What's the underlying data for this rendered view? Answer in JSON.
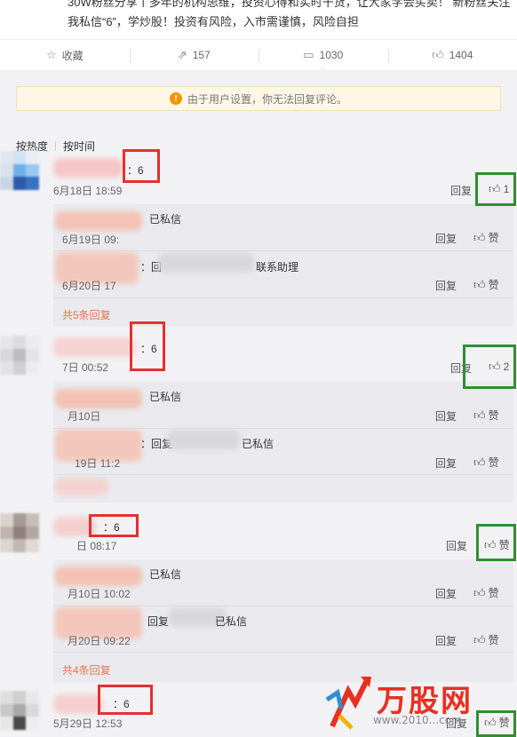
{
  "post": {
    "text": "30W粉丝分享丨多年的机构思维，投资心得和实时干货，让大家学会买卖！ 新粉丝关注我私信“6”，学炒股！投资有风险，入市需谨慎，风险自担"
  },
  "actions": {
    "favorite": "收藏",
    "forward": "157",
    "comment": "1030",
    "like": "1404"
  },
  "notice": "由于用户设置，你无法回复评论。",
  "sort": {
    "hot": "按热度",
    "time": "按时间"
  },
  "comments": [
    {
      "text": "：6",
      "time": "6月18日 18:59",
      "reply": "回复",
      "likes": "1",
      "subs": [
        {
          "text": "已私信",
          "time": "6月19日 09:",
          "reply": "回复",
          "like": "赞"
        },
        {
          "text": "：回",
          "text2": "联系助理",
          "time": "6月20日 17",
          "reply": "回复",
          "like": "赞"
        }
      ],
      "more": "共5条回复"
    },
    {
      "text": "：6",
      "time": "7日 00:52",
      "reply": "回复",
      "likes": "2",
      "subs": [
        {
          "text": "已私信",
          "time": "月10日",
          "reply": "回复",
          "like": "赞"
        },
        {
          "text": "：回复",
          "text2": "已私信",
          "time": "19日 11:2",
          "reply": "回复",
          "like": "赞"
        }
      ],
      "more": ""
    },
    {
      "text": "：6",
      "time": "日 08:17",
      "reply": "回复",
      "likes": "赞",
      "subs": [
        {
          "text": "已私信",
          "time": "月10日 10:02",
          "reply": "回复",
          "like": "赞"
        },
        {
          "text": "回复",
          "text2": "已私信",
          "time": "月20日 09:22",
          "reply": "回复",
          "like": "赞"
        }
      ],
      "more": "共4条回复"
    },
    {
      "text": "：6",
      "time": "5月29日 12:53",
      "reply": "回复",
      "likes": "赞",
      "subs": [],
      "more": ""
    }
  ],
  "watermark": {
    "brand": "万股网",
    "url": "www.2010...com"
  },
  "icons": {
    "favorite": "star-icon",
    "forward": "share-icon",
    "comment": "comment-icon",
    "like": "thumb-up-icon",
    "warning": "warning-icon"
  },
  "colors": {
    "accent": "#eb7350",
    "highlight_red": "#e53030",
    "highlight_green": "#2f8f2f",
    "notice_bg": "#fff7e6"
  }
}
